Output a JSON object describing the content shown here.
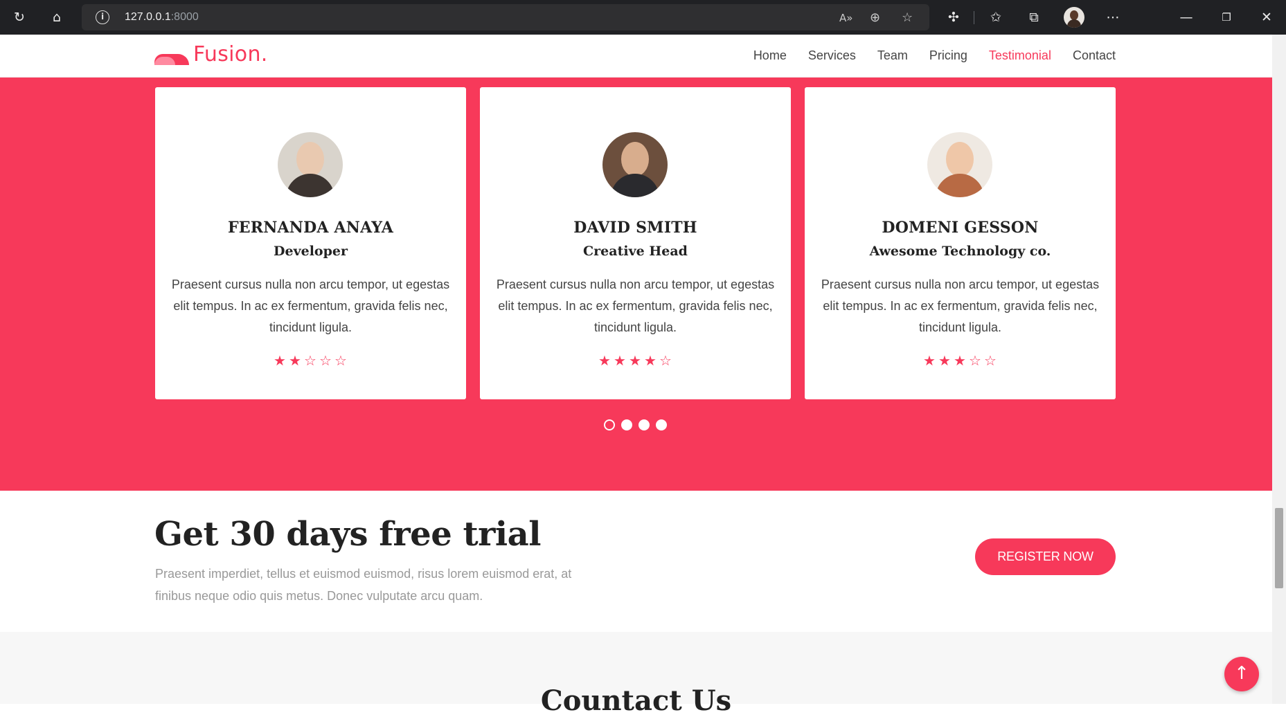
{
  "browser": {
    "url_host": "127.0.0.1",
    "url_port": ":8000",
    "icons": [
      "refresh-icon",
      "home-icon",
      "info-icon",
      "read-aloud-icon",
      "zoom-icon",
      "favorite-add-icon",
      "extensions-icon",
      "favorites-icon",
      "collections-icon",
      "profile-avatar",
      "more-icon",
      "minimize-icon",
      "restore-icon",
      "close-icon"
    ]
  },
  "nav": {
    "logo": "Fusion.",
    "links": [
      "Home",
      "Services",
      "Team",
      "Pricing",
      "Testimonial",
      "Contact"
    ],
    "active": "Testimonial"
  },
  "testimonials": [
    {
      "name": "FERNANDA ANAYA",
      "role": "Developer",
      "quote": "Praesent cursus nulla non arcu tempor, ut egestas elit tempus. In ac ex fermentum, gravida felis nec, tincidunt ligula.",
      "rating": 2,
      "max_rating": 5
    },
    {
      "name": "DAVID SMITH",
      "role": "Creative Head",
      "quote": "Praesent cursus nulla non arcu tempor, ut egestas elit tempus. In ac ex fermentum, gravida felis nec, tincidunt ligula.",
      "rating": 4,
      "max_rating": 5
    },
    {
      "name": "DOMENI GESSON",
      "role": "Awesome Technology co.",
      "quote": "Praesent cursus nulla non arcu tempor, ut egestas elit tempus. In ac ex fermentum, gravida felis nec, tincidunt ligula.",
      "rating": 3,
      "max_rating": 5
    }
  ],
  "carousel": {
    "count": 4,
    "active_index": 0
  },
  "trial": {
    "title": "Get 30 days free trial",
    "description": "Praesent imperdiet, tellus et euismod euismod, risus lorem euismod erat, at finibus neque odio quis metus. Donec vulputate arcu quam.",
    "button": "REGISTER NOW"
  },
  "contact": {
    "title": "Countact Us"
  },
  "back_to_top": "↑",
  "colors": {
    "accent": "#f7395a",
    "chrome": "#202124"
  }
}
